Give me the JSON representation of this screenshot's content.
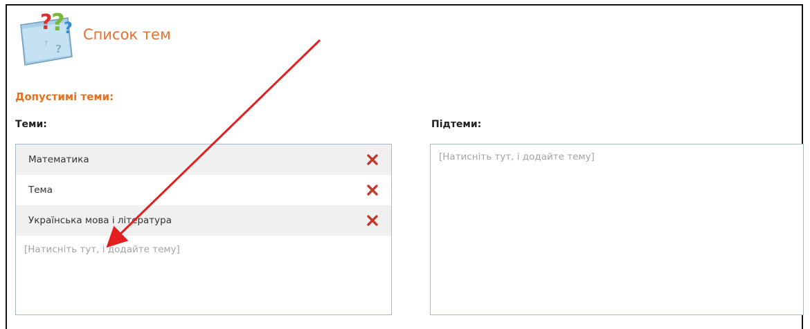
{
  "header": {
    "title": "Список тем"
  },
  "section": {
    "heading": "Допустимі теми:"
  },
  "topics": {
    "label": "Теми:",
    "items": [
      {
        "label": "Математика"
      },
      {
        "label": "Тема"
      },
      {
        "label": "Українська мова і література"
      }
    ],
    "add_placeholder": "[Натисніть тут, і додайте тему]"
  },
  "subtopics": {
    "label": "Підтеми:",
    "add_placeholder": "[Натисніть тут, і додайте тему]"
  },
  "colors": {
    "accent": "#e9702a",
    "delete": "#c0392b",
    "arrow": "#e31e1e",
    "border": "#a9b7c6"
  },
  "icons": {
    "logo": "question-folder-icon",
    "delete": "delete-x-icon"
  }
}
